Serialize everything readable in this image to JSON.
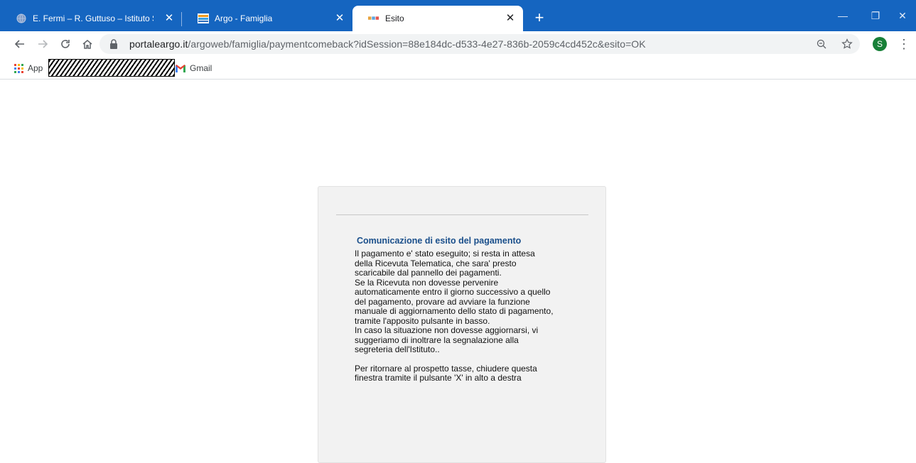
{
  "tabs": [
    {
      "title": "E. Fermi – R. Guttuso – Istituto St",
      "close": "✕",
      "favicon": "globe-icon"
    },
    {
      "title": "Argo - Famiglia",
      "close": "✕",
      "favicon": "argo-logo-icon"
    },
    {
      "title": "Esito",
      "close": "✕",
      "favicon": "argo-dots-icon",
      "active": true
    }
  ],
  "new_tab_label": "+",
  "window_controls": {
    "minimize": "—",
    "maximize": "❐",
    "close": "✕"
  },
  "toolbar": {
    "url_domain": "portaleargo.it",
    "url_path": "/argoweb/famiglia/paymentcomeback?idSession=88e184dc-d533-4e27-836b-2059c4cd452c&esito=OK",
    "avatar_letter": "S"
  },
  "bookmarks": {
    "apps_label": "App",
    "gmail_label": "Gmail"
  },
  "content": {
    "heading": "Comunicazione di esito del pagamento",
    "paragraph1": "Il pagamento e' stato eseguito; si resta in attesa\ndella Ricevuta Telematica, che sara' presto\nscaricabile dal pannello dei pagamenti.\nSe la Ricevuta non dovesse pervenire\nautomaticamente entro il giorno successivo a quello\ndel pagamento, provare ad avviare la funzione\nmanuale di aggiornamento dello stato di pagamento,\ntramite l'apposito pulsante in basso.\nIn caso la situazione non dovesse aggiornarsi, vi\nsuggeriamo di inoltrare la segnalazione alla\nsegreteria dell'Istituto..",
    "paragraph2": "Per ritornare al prospetto tasse, chiudere questa\nfinestra tramite il pulsante 'X' in alto a destra"
  },
  "colors": {
    "tabstrip": "#1565c0",
    "heading": "#1a4f8b",
    "card": "#f2f2f2",
    "avatar": "#188038"
  }
}
